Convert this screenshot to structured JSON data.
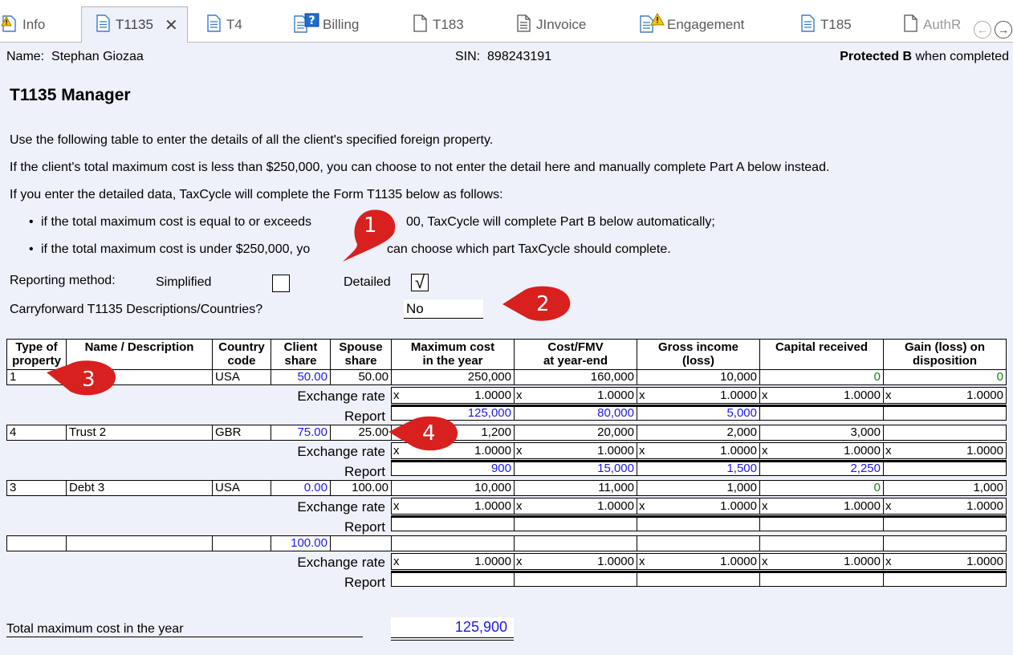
{
  "tabs": [
    {
      "label": "Info",
      "icon": "warning-doc-icon"
    },
    {
      "label": "T1135",
      "icon": "doc-icon",
      "active": true
    },
    {
      "label": "T4",
      "icon": "doc-icon"
    },
    {
      "label": "Billing",
      "icon": "help-doc-icon"
    },
    {
      "label": "T183",
      "icon": "page-icon"
    },
    {
      "label": "JInvoice",
      "icon": "page-lines-icon"
    },
    {
      "label": "Engagement",
      "icon": "warning-doc-icon"
    },
    {
      "label": "T185",
      "icon": "doc-icon"
    },
    {
      "label": "AuthR",
      "icon": "page-icon"
    }
  ],
  "header": {
    "name_label": "Name:",
    "name_value": "Stephan Giozaa",
    "sin_label": "SIN:",
    "sin_value": "898243191",
    "protected_bold": "Protected B",
    "protected_rest": "when completed"
  },
  "title": "T1135 Manager",
  "instructions": {
    "p1": "Use the following table to enter the details of all the client's specified foreign property.",
    "p2": "If the client's total maximum cost is less than $250,000, you can choose to not enter the detail here and manually complete Part A below instead.",
    "p3": "If you enter the detailed data, TaxCycle will complete the Form T1135 below as follows:",
    "b1a": "if the total maximum cost is equal to or exceeds",
    "b1b": "00, TaxCycle will complete Part B below automatically;",
    "b2a": "if the total maximum cost is under $250,000, yo",
    "b2b": "can choose which part TaxCycle should complete."
  },
  "reporting": {
    "label": "Reporting method:",
    "simplified": "Simplified",
    "detailed": "Detailed",
    "simplified_checked": false,
    "detailed_checked": true,
    "check_glyph": "√"
  },
  "carryforward": {
    "label": "Carryforward T1135 Descriptions/Countries?",
    "value": "No"
  },
  "table": {
    "headers": {
      "type": [
        "Type of",
        "property"
      ],
      "name": [
        "Name / Description"
      ],
      "country": [
        "Country",
        "code"
      ],
      "client": [
        "Client",
        "share"
      ],
      "spouse": [
        "Spouse",
        "share"
      ],
      "maxcost": [
        "Maximum cost",
        "in the year"
      ],
      "costfmv": [
        "Cost/FMV",
        "at year-end"
      ],
      "gross": [
        "Gross income",
        "(loss)"
      ],
      "capital": [
        "Capital received"
      ],
      "gain": [
        "Gain (loss) on",
        "disposition"
      ]
    },
    "exchange_label": "Exchange rate",
    "report_label": "Report",
    "x_mark": "x",
    "rows": [
      {
        "type": "1",
        "name": "",
        "country": "USA",
        "client": "50.00",
        "spouse": "50.00",
        "maxcost": "250,000",
        "costfmv": "160,000",
        "gross": "10,000",
        "capital": "0",
        "gain": "0",
        "rates": [
          "1.0000",
          "1.0000",
          "1.0000",
          "1.0000",
          "1.0000"
        ],
        "report": [
          "125,000",
          "80,000",
          "5,000",
          "",
          ""
        ]
      },
      {
        "type": "4",
        "name": "Trust 2",
        "country": "GBR",
        "client": "75.00",
        "spouse": "25.00",
        "maxcost": "1,200",
        "costfmv": "20,000",
        "gross": "2,000",
        "capital": "3,000",
        "gain": "",
        "rates": [
          "1.0000",
          "1.0000",
          "1.0000",
          "1.0000",
          "1.0000"
        ],
        "report": [
          "900",
          "15,000",
          "1,500",
          "2,250",
          ""
        ]
      },
      {
        "type": "3",
        "name": "Debt 3",
        "country": "USA",
        "client": "0.00",
        "spouse": "100.00",
        "maxcost": "10,000",
        "costfmv": "11,000",
        "gross": "1,000",
        "capital": "0",
        "gain": "1,000",
        "rates": [
          "1.0000",
          "1.0000",
          "1.0000",
          "1.0000",
          "1.0000"
        ],
        "report": [
          "",
          "",
          "",
          "",
          ""
        ]
      },
      {
        "type": "",
        "name": "",
        "country": "",
        "client": "100.00",
        "spouse": "",
        "maxcost": "",
        "costfmv": "",
        "gross": "",
        "capital": "",
        "gain": "",
        "rates": [
          "1.0000",
          "1.0000",
          "1.0000",
          "1.0000",
          "1.0000"
        ],
        "report": [
          "",
          "",
          "",
          "",
          ""
        ]
      }
    ]
  },
  "total": {
    "label": "Total maximum cost in the year",
    "value": "125,900"
  },
  "callouts": [
    "1",
    "2",
    "3",
    "4"
  ],
  "colors": {
    "accent_blue": "#1a1aee",
    "zero_green": "#118811",
    "callout_red": "#d8201e",
    "page_bg": "#eef0fa"
  }
}
